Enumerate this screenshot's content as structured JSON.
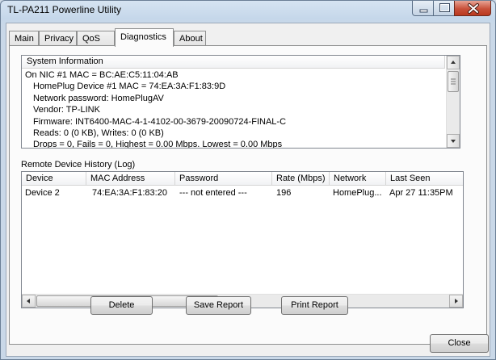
{
  "window": {
    "title": "TL-PA211 Powerline Utility"
  },
  "tabs": [
    {
      "label": "Main"
    },
    {
      "label": "Privacy"
    },
    {
      "label": "QoS"
    },
    {
      "label": "Diagnostics",
      "active": true
    },
    {
      "label": "About"
    }
  ],
  "system_information": {
    "header": "System Information",
    "lines": [
      "On NIC #1 MAC = BC:AE:C5:11:04:AB",
      "HomePlug Device #1 MAC = 74:EA:3A:F1:83:9D",
      "Network password: HomePlugAV",
      "Vendor: TP-LINK",
      "Firmware: INT6400-MAC-4-1-4102-00-3679-20090724-FINAL-C",
      "Reads: 0 (0 KB), Writes: 0 (0 KB)",
      "Drops = 0, Fails = 0, Highest = 0.00 Mbps. Lowest = 0.00 Mbps"
    ]
  },
  "remote_log": {
    "label": "Remote Device History (Log)",
    "columns": [
      "Device",
      "MAC Address",
      "Password",
      "Rate (Mbps)",
      "Network",
      "Last Seen"
    ],
    "rows": [
      [
        "Device 2",
        "74:EA:3A:F1:83:20",
        "--- not entered ---",
        "196",
        "HomePlug...",
        "Apr 27 11:35PM"
      ]
    ]
  },
  "buttons": {
    "delete": "Delete",
    "save_report": "Save Report",
    "print_report": "Print Report",
    "close": "Close"
  },
  "colors": {
    "window_frame": "#c5d7ea",
    "close_button": "#c8513a",
    "panel": "#fbfbfb"
  }
}
